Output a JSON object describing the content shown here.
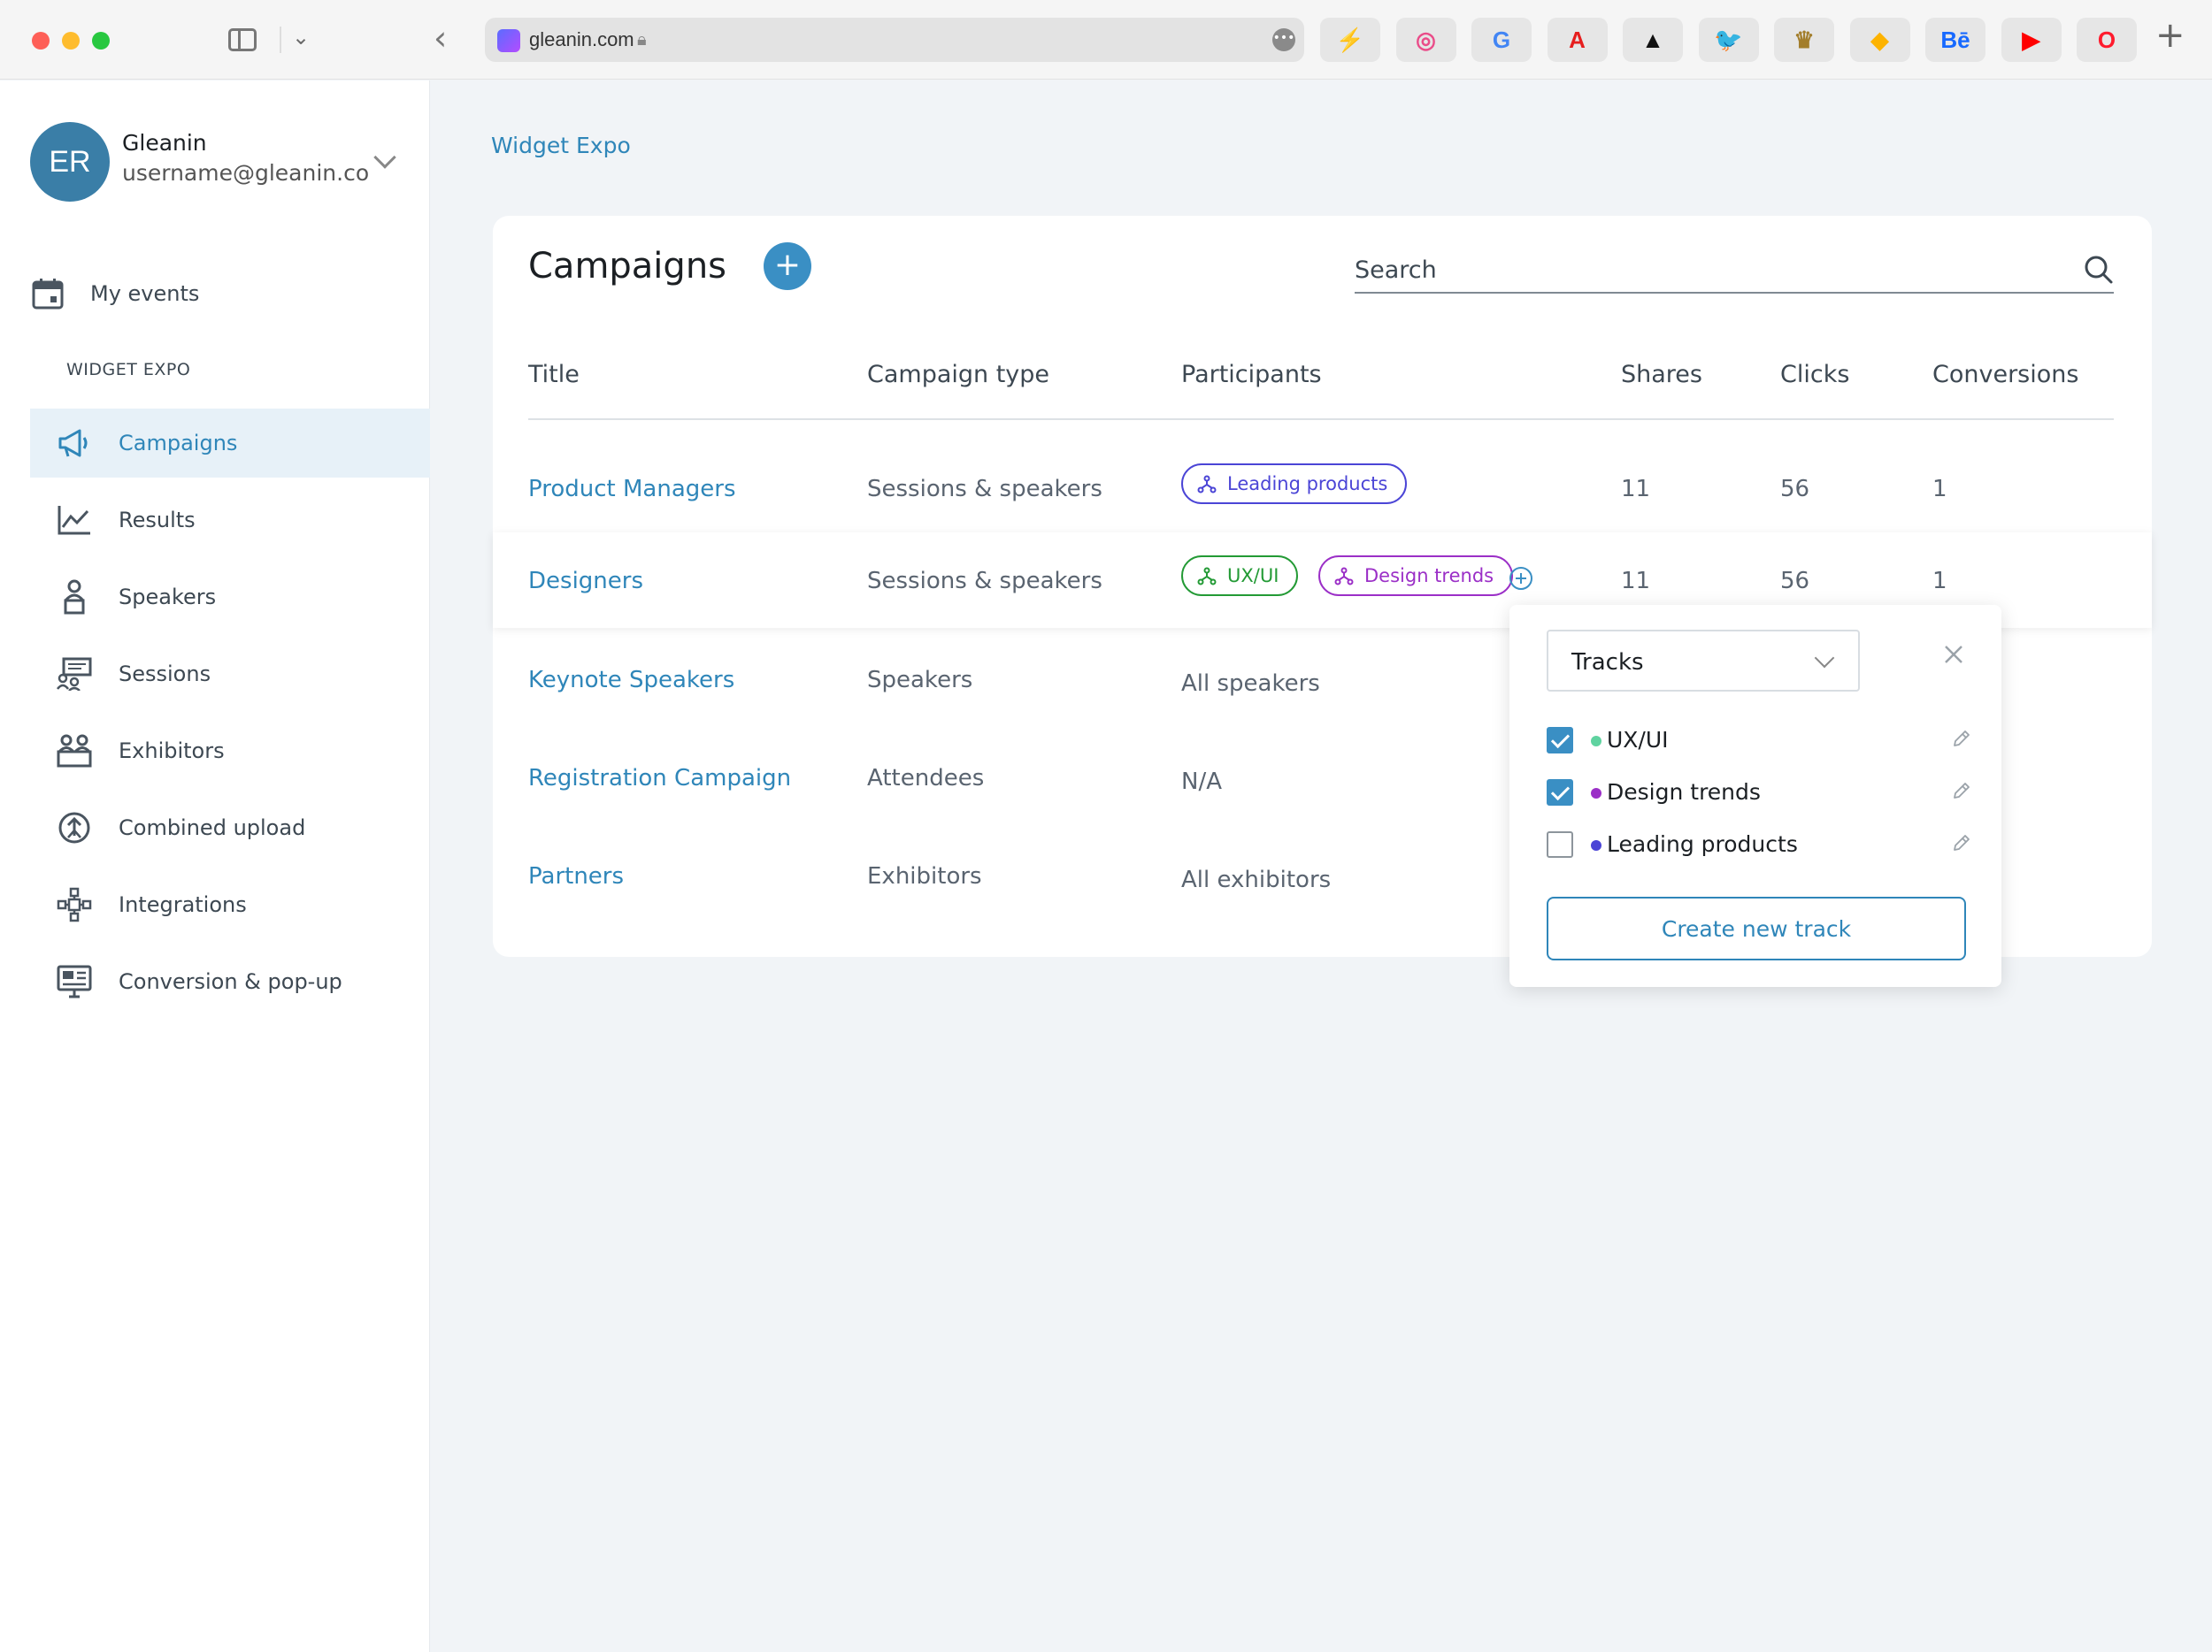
{
  "browser": {
    "url": "gleanin.com",
    "bookmarks": [
      {
        "icon": "bolt-bookmark-icon",
        "glyph": "⚡",
        "color": "#f0b400"
      },
      {
        "icon": "dribbble-bookmark-icon",
        "glyph": "◎",
        "color": "#ea4c89"
      },
      {
        "icon": "google-bookmark-icon",
        "glyph": "G",
        "color": "#4285f4"
      },
      {
        "icon": "adobe-bookmark-icon",
        "glyph": "A",
        "color": "#e61e1e"
      },
      {
        "icon": "adidas-bookmark-icon",
        "glyph": "▲",
        "color": "#111111"
      },
      {
        "icon": "twitter-bookmark-icon",
        "glyph": "🐦",
        "color": "#1da1f2"
      },
      {
        "icon": "crown-bookmark-icon",
        "glyph": "♛",
        "color": "#a37e2c"
      },
      {
        "icon": "sketch-bookmark-icon",
        "glyph": "◆",
        "color": "#fdb300"
      },
      {
        "icon": "behance-bookmark-icon",
        "glyph": "Bē",
        "color": "#1769ff"
      },
      {
        "icon": "youtube-bookmark-icon",
        "glyph": "▶",
        "color": "#ff0000"
      },
      {
        "icon": "opera-bookmark-icon",
        "glyph": "O",
        "color": "#ff1b2d"
      }
    ]
  },
  "user": {
    "initials": "ER",
    "name": "Gleanin",
    "email": "username@gleanin.co..."
  },
  "sidebar": {
    "my_events": "My events",
    "section": "WIDGET EXPO",
    "items": [
      {
        "label": "Campaigns",
        "icon": "megaphone-icon",
        "active": true
      },
      {
        "label": "Results",
        "icon": "chart-line-icon"
      },
      {
        "label": "Speakers",
        "icon": "speaker-podium-icon"
      },
      {
        "label": "Sessions",
        "icon": "presentation-icon"
      },
      {
        "label": "Exhibitors",
        "icon": "booth-icon"
      },
      {
        "label": "Combined upload",
        "icon": "upload-person-icon"
      },
      {
        "label": "Integrations",
        "icon": "integration-nodes-icon"
      },
      {
        "label": "Conversion & pop-up",
        "icon": "monitor-popup-icon"
      }
    ]
  },
  "breadcrumb": "Widget Expo",
  "campaigns": {
    "title": "Campaigns",
    "add_label": "+",
    "search_placeholder": "Search",
    "columns": [
      "Title",
      "Campaign type",
      "Participants",
      "Shares",
      "Clicks",
      "Conversions"
    ],
    "rows": [
      {
        "title": "Product Managers",
        "type": "Sessions & speakers",
        "participants_text": "",
        "tags": [
          {
            "label": "Leading products",
            "style": "purple-blue"
          }
        ],
        "shares": "11",
        "clicks": "56",
        "conversions": "1"
      },
      {
        "title": "Designers",
        "type": "Sessions & speakers",
        "participants_text": "",
        "tags": [
          {
            "label": "UX/UI",
            "style": "green"
          },
          {
            "label": "Design trends",
            "style": "magenta"
          }
        ],
        "shares": "11",
        "clicks": "56",
        "conversions": "1"
      },
      {
        "title": "Keynote Speakers",
        "type": "Speakers",
        "participants_text": "All speakers",
        "tags": [],
        "shares": "",
        "clicks": "",
        "conversions": ""
      },
      {
        "title": "Registration Campaign",
        "type": "Attendees",
        "participants_text": "N/A",
        "tags": [],
        "shares": "",
        "clicks": "",
        "conversions": ""
      },
      {
        "title": "Partners",
        "type": "Exhibitors",
        "participants_text": "All exhibitors",
        "tags": [],
        "shares": "",
        "clicks": "",
        "conversions": ""
      }
    ]
  },
  "tracks_popover": {
    "select_value": "Tracks",
    "tracks": [
      {
        "label": "UX/UI",
        "checked": true,
        "color": "#5fd3a0"
      },
      {
        "label": "Design trends",
        "checked": true,
        "color": "#9b2fc7"
      },
      {
        "label": "Leading products",
        "checked": false,
        "color": "#4b45d6"
      }
    ],
    "create_label": "Create new track"
  },
  "colors": {
    "accent": "#2f86b9",
    "button": "#3a8fc4",
    "active_bg": "#e7f1f8"
  }
}
